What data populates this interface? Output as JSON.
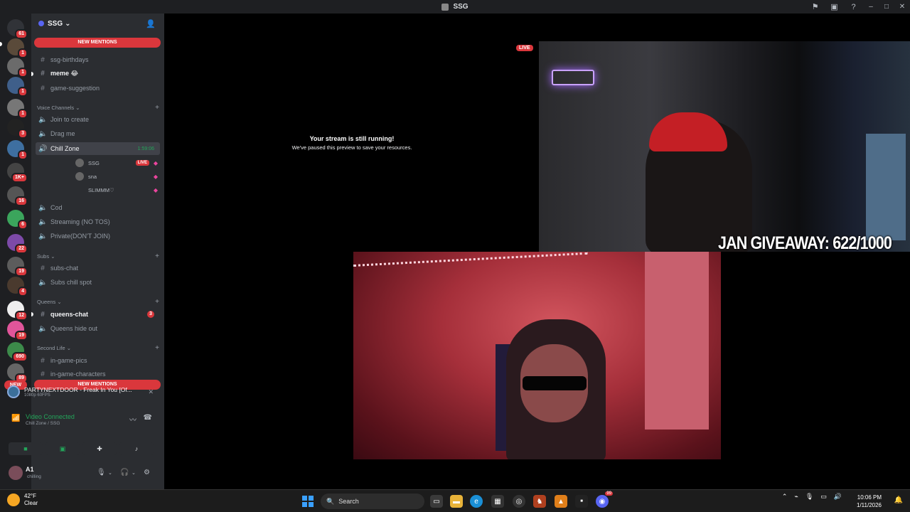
{
  "window": {
    "title": "SSG"
  },
  "rail": {
    "servers": [
      {
        "badge": "61"
      },
      {
        "badge": "1"
      },
      {
        "badge": "1"
      },
      {
        "badge": "1"
      },
      {
        "badge": "1"
      },
      {
        "badge": "3"
      },
      {
        "badge": "1"
      },
      {
        "badge": "1K+"
      },
      {
        "badge": "16"
      },
      {
        "badge": "6"
      },
      {
        "badge": "22"
      },
      {
        "badge": "19"
      },
      {
        "badge": "4"
      },
      {
        "badge": "12"
      },
      {
        "badge": "19"
      },
      {
        "badge": "690"
      },
      {
        "badge": "89"
      }
    ],
    "new_label": "NEW"
  },
  "guild": {
    "name": "SSG",
    "chevron": "⌄"
  },
  "mentions_top": "NEW MENTIONS",
  "mentions_bottom": "NEW MENTIONS",
  "text_channels_top": [
    {
      "name": "ssg-birthdays",
      "unread": false
    },
    {
      "name": "meme 😂",
      "unread": true
    },
    {
      "name": "game-suggestion",
      "unread": false
    }
  ],
  "categories": {
    "voice": "Voice Channels",
    "subs": "Subs",
    "queens": "Queens",
    "second_life": "Second Life"
  },
  "voice_channels": [
    {
      "name": "Join to create"
    },
    {
      "name": "Drag me"
    },
    {
      "name": "Chill Zone",
      "time": "1:59:06"
    }
  ],
  "voice_users": [
    {
      "name": "SSG",
      "live": "LIVE"
    },
    {
      "name": "sna"
    },
    {
      "name": "SLIMMM♡"
    }
  ],
  "voice_channels_2": [
    {
      "name": "Cod"
    },
    {
      "name": "Streaming (NO TOS)"
    },
    {
      "name": "Private(DON'T JOIN)"
    }
  ],
  "subs_channels": [
    {
      "name": "subs-chat"
    },
    {
      "name": "Subs chill spot"
    }
  ],
  "queens_channels": [
    {
      "name": "queens-chat",
      "mention": "3"
    },
    {
      "name": "Queens hide out"
    }
  ],
  "second_life_channels": [
    {
      "name": "in-game-pics"
    },
    {
      "name": "in-game-characters"
    }
  ],
  "activity": {
    "title": "PARTYNEXTDOOR - Freak In You [Of...",
    "quality": "1080p 60FPS"
  },
  "rtc": {
    "status": "Video Connected",
    "location": "Chill Zone / SSG"
  },
  "user": {
    "name": "A1",
    "status": "chilling"
  },
  "stage": {
    "paused_title": "Your stream is still running!",
    "paused_sub": "We've paused this preview to save your resources.",
    "live_badge": "LIVE",
    "giveaway": "JAN GIVEAWAY: 622/1000"
  },
  "taskbar": {
    "weather_temp": "42°F",
    "weather_desc": "Clear",
    "search": "Search",
    "discord_badge": "99",
    "time": "10:06 PM",
    "date": "1/11/2026"
  },
  "colors": {
    "accent": "#5865f2",
    "danger": "#da373c",
    "connected": "#23a55a"
  }
}
